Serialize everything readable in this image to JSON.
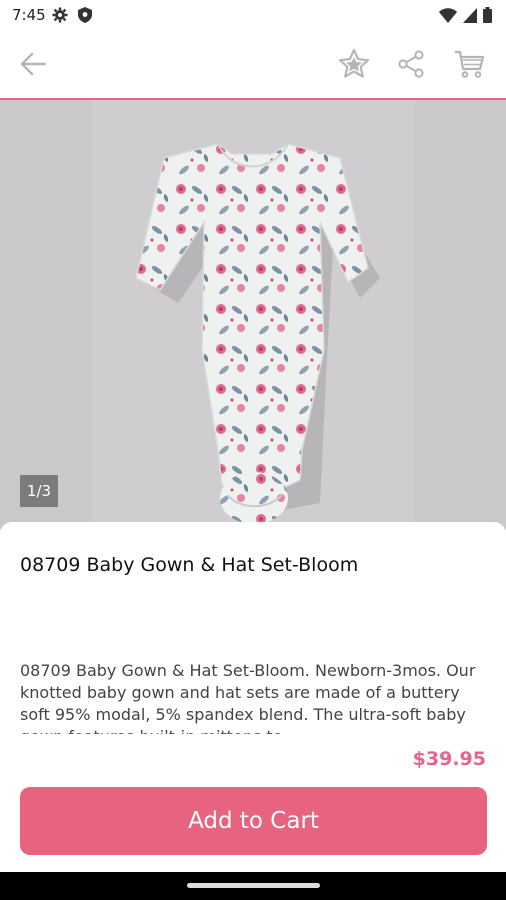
{
  "status_bar": {
    "time": "7:45",
    "left_icons": [
      "gear-icon",
      "shield-icon"
    ],
    "right_icons": [
      "wifi-icon",
      "signal-icon",
      "battery-icon"
    ]
  },
  "toolbar": {
    "icons": [
      "back-arrow-icon",
      "star-icon",
      "share-icon",
      "cart-icon"
    ],
    "accent_color": "#e7628c"
  },
  "gallery": {
    "counter": "1/3"
  },
  "product": {
    "title": "08709 Baby Gown & Hat Set-Bloom",
    "description": "08709 Baby Gown & Hat Set-Bloom. Newborn-3mos. Our knotted baby gown and hat sets are made of a buttery soft 95% modal, 5% spandex blend. The ultra-soft baby gown features built-in mittens to",
    "price": "$39.95",
    "price_color": "#e7628c"
  },
  "cta": {
    "add_to_cart": "Add to Cart",
    "button_color": "#e7637f"
  }
}
